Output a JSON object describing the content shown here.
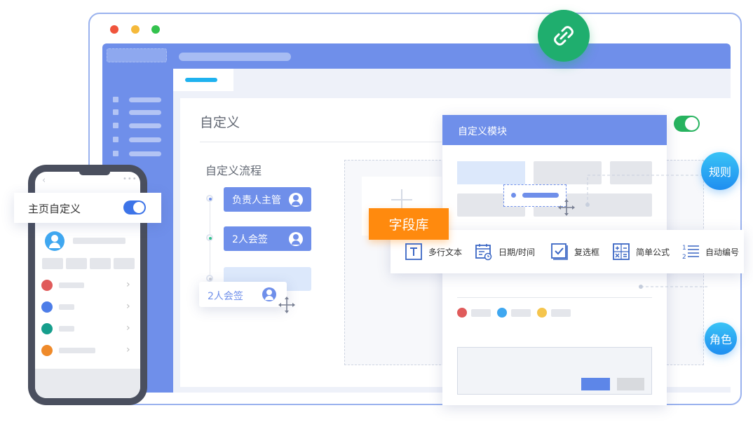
{
  "main_panel": {
    "title": "自定义",
    "flow_title": "自定义流程",
    "flow_items": [
      {
        "label": "负责人主管"
      },
      {
        "label": "2人会签"
      }
    ],
    "dragging_item": {
      "label": "2人会签"
    }
  },
  "module_card": {
    "header": "自定义模块"
  },
  "field_library": {
    "label": "字段库",
    "items": [
      {
        "label": "多行文本",
        "icon": "text-icon"
      },
      {
        "label": "日期/时间",
        "icon": "calendar-icon"
      },
      {
        "label": "复选框",
        "icon": "checkbox-icon"
      },
      {
        "label": "简单公式",
        "icon": "formula-icon"
      },
      {
        "label": "自动编号",
        "icon": "numbered-list-icon"
      }
    ]
  },
  "badges": {
    "rules": "规则",
    "roles": "角色"
  },
  "phone": {
    "homepage_toggle_label": "主页自定义",
    "toggle_on": true
  },
  "colors": {
    "primary_blue": "#6f8fea",
    "toggle_green": "#27b35f",
    "link_green": "#1fae6e",
    "field_orange": "#ff8a0e",
    "dot_red": "#e05b5b",
    "dot_blue": "#3fa7f0",
    "dot_yellow": "#f5c54d",
    "teal": "#169e8c"
  }
}
